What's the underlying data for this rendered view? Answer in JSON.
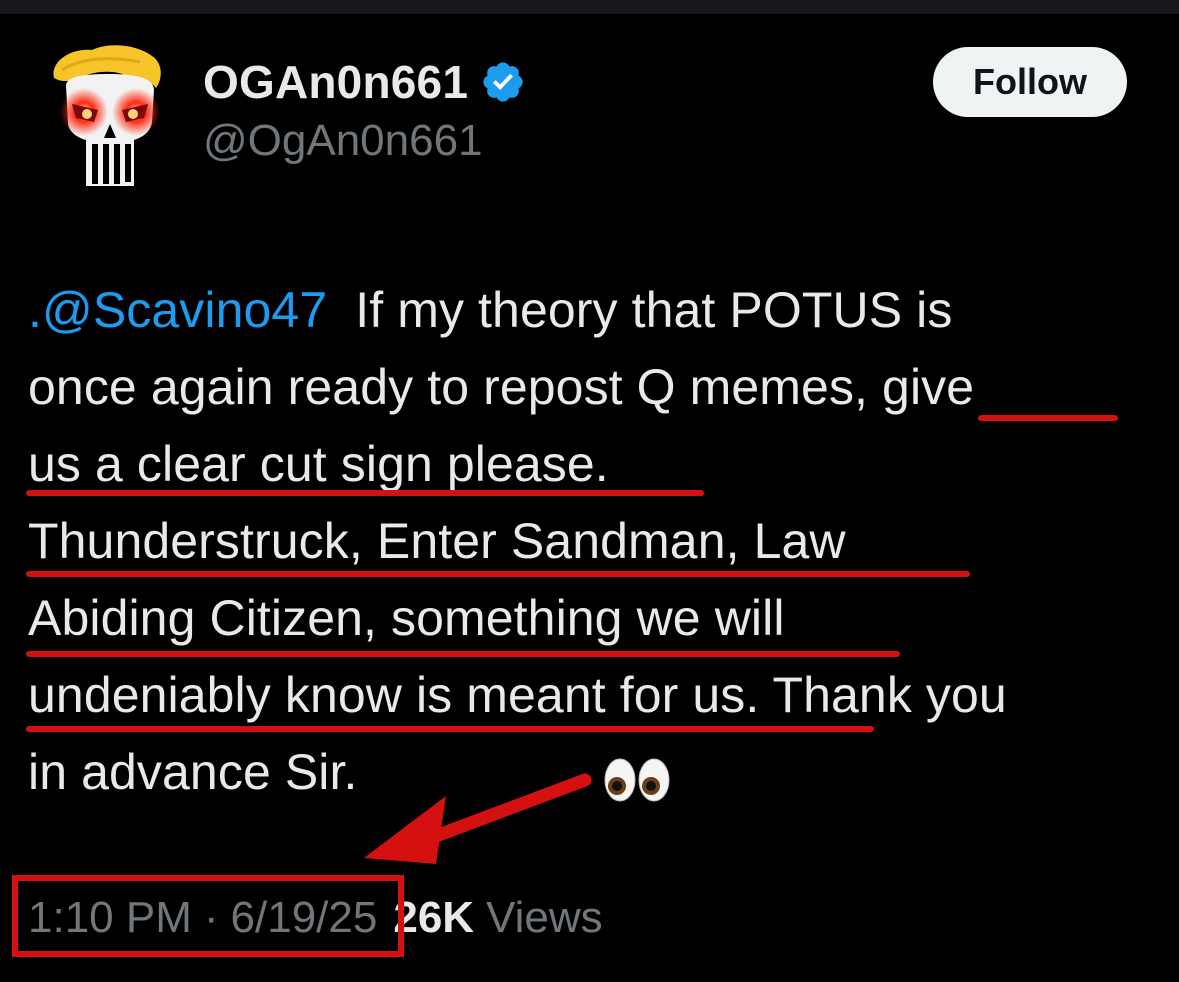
{
  "user": {
    "display_name": "OGAn0n661",
    "handle": "@OgAn0n661",
    "verified": true,
    "avatar_icon": "punisher-skull-avatar"
  },
  "follow_label": "Follow",
  "tweet": {
    "mention": ".@Scavino47",
    "lines": [
      "If my theory that POTUS is",
      "once again ready to repost Q memes, give",
      "us a clear cut sign please.",
      "Thunderstruck, Enter Sandman, Law",
      "Abiding Citizen, something we will",
      "undeniably know is meant for us. Thank you",
      "in advance Sir."
    ],
    "emoji": "👀"
  },
  "meta": {
    "time": "1:10 PM",
    "separator": "·",
    "date": "6/19/25",
    "views_count": "26K",
    "views_label": "Views"
  },
  "colors": {
    "background": "#000000",
    "text": "#e7e9ea",
    "muted": "#71767b",
    "link": "#1d9bf0",
    "annotation_red": "#d41010",
    "verified_blue": "#1d9bf0"
  }
}
